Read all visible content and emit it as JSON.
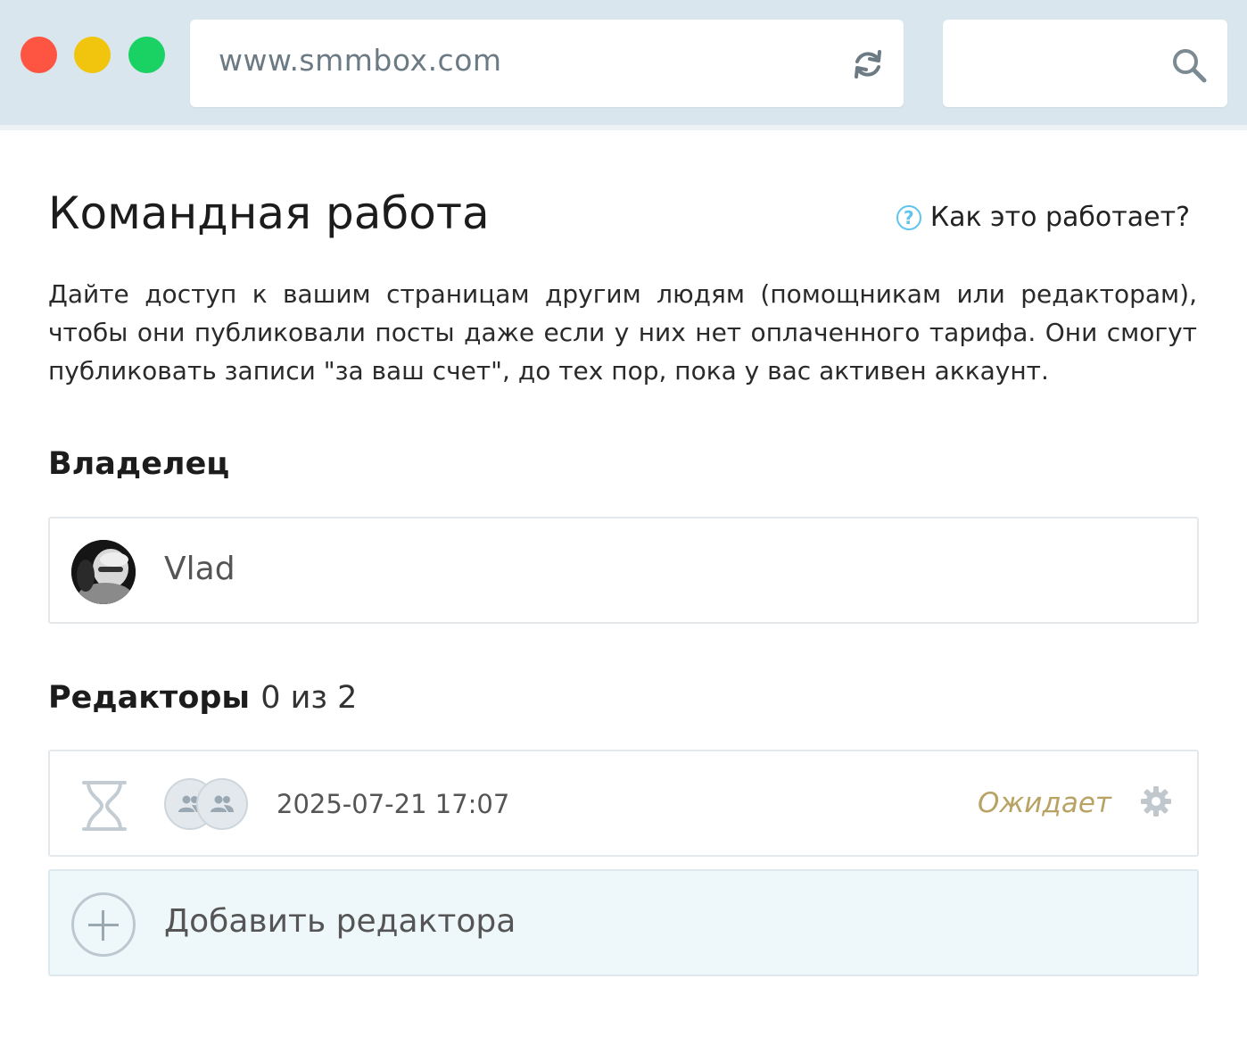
{
  "browser": {
    "url": "www.smmbox.com"
  },
  "page": {
    "title": "Командная работа",
    "help_link": "Как это работает?",
    "description": "Дайте доступ к вашим страницам другим людям (помощникам или редакторам), чтобы они публиковали посты даже если у них нет оплаченного тарифа. Они смогут публиковать записи \"за ваш счет\", до тех пор, пока у вас активен аккаунт."
  },
  "owner": {
    "heading": "Владелец",
    "name": "Vlad"
  },
  "editors": {
    "heading": "Редакторы",
    "count": "0 из 2",
    "rows": [
      {
        "date": "2025-07-21 17:07",
        "status": "Ожидает"
      }
    ],
    "add_label": "Добавить редактора"
  },
  "colors": {
    "chrome": "#d9e6ee",
    "status_pending": "#b8a264",
    "help_icon": "#5ec4ee",
    "add_row_bg": "#eef7fa"
  }
}
